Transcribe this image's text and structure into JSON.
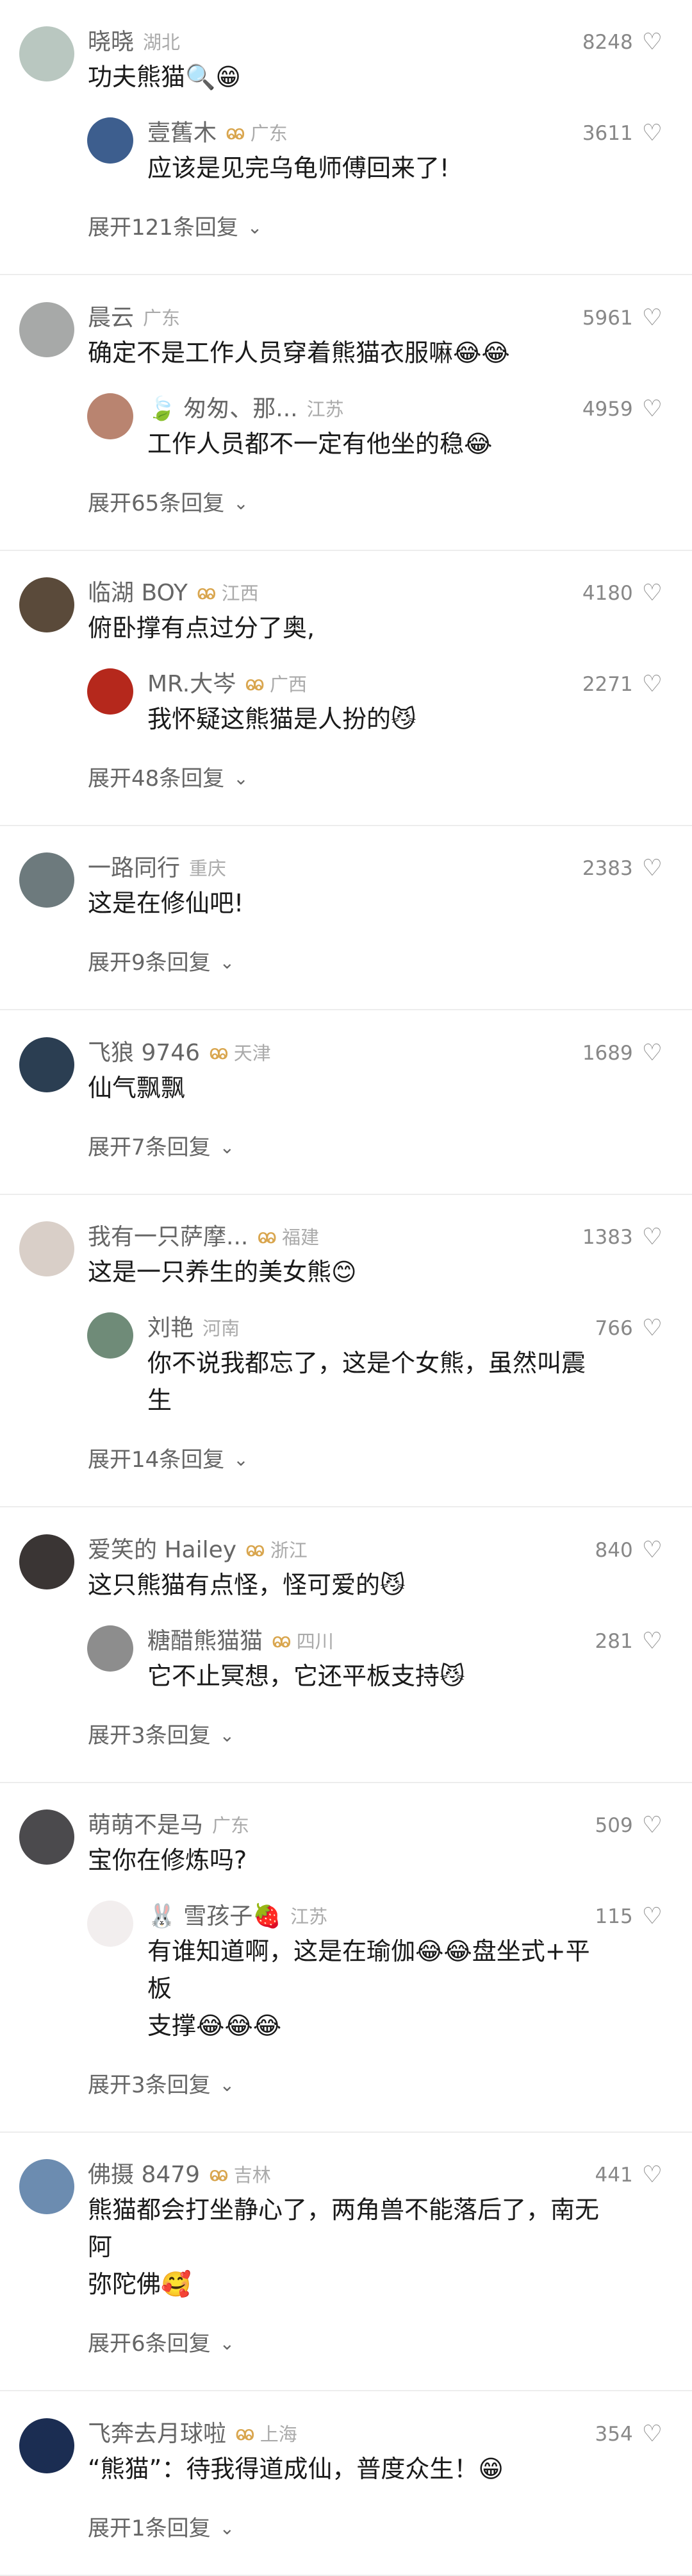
{
  "comments": [
    {
      "avatar_color": "#b9c7c0",
      "name": "晓晓",
      "fan": false,
      "location": "湖北",
      "likes": "8248",
      "text": "功夫熊猫🔍😁",
      "reply": {
        "avatar_color": "#3d5e8e",
        "name": "壹舊木",
        "fan": true,
        "location": "广东",
        "likes": "3611",
        "text": "应该是见完乌龟师傅回来了!"
      },
      "expand": "展开121条回复"
    },
    {
      "avatar_color": "#a7a9a8",
      "name": "晨云",
      "fan": false,
      "location": "广东",
      "likes": "5961",
      "text": "确定不是工作人员穿着熊猫衣服嘛😂😂",
      "reply": {
        "avatar_color": "#b98470",
        "name": "🍃 匆匆、那...",
        "fan": false,
        "location": "江苏",
        "likes": "4959",
        "text": "工作人员都不一定有他坐的稳😂"
      },
      "expand": "展开65条回复"
    },
    {
      "avatar_color": "#5a4a3a",
      "name": "临湖 BOY",
      "fan": true,
      "location": "江西",
      "likes": "4180",
      "text": "俯卧撑有点过分了奥,",
      "reply": {
        "avatar_color": "#b5281c",
        "name": "MR.大岑",
        "fan": true,
        "location": "广西",
        "likes": "2271",
        "text": "我怀疑这熊猫是人扮的😼"
      },
      "expand": "展开48条回复"
    },
    {
      "avatar_color": "#6d7a7d",
      "name": "一路同行",
      "fan": false,
      "location": "重庆",
      "likes": "2383",
      "text": "这是在修仙吧!",
      "reply": null,
      "expand": "展开9条回复"
    },
    {
      "avatar_color": "#2b3e52",
      "name": "飞狼 9746",
      "fan": true,
      "location": "天津",
      "likes": "1689",
      "text": "仙气飘飘",
      "reply": null,
      "expand": "展开7条回复"
    },
    {
      "avatar_color": "#d9cfc8",
      "name": "我有一只萨摩...",
      "fan": true,
      "location": "福建",
      "likes": "1383",
      "text": "这是一只养生的美女熊😊",
      "reply": {
        "avatar_color": "#6f8b78",
        "name": "刘艳",
        "fan": false,
        "location": "河南",
        "likes": "766",
        "text": "你不说我都忘了，这是个女熊，虽然叫震生"
      },
      "expand": "展开14条回复"
    },
    {
      "avatar_color": "#3a3534",
      "name": "爱笑的 Hailey",
      "fan": true,
      "location": "浙江",
      "likes": "840",
      "text": "这只熊猫有点怪，怪可爱的😼",
      "reply": {
        "avatar_color": "#8d8d8d",
        "name": "糖醋熊猫猫",
        "fan": true,
        "location": "四川",
        "likes": "281",
        "text": "它不止冥想，它还平板支持😼"
      },
      "expand": "展开3条回复"
    },
    {
      "avatar_color": "#4b4a4d",
      "name": "萌萌不是马",
      "fan": false,
      "location": "广东",
      "likes": "509",
      "text": "宝你在修炼吗?",
      "reply": {
        "avatar_color": "#f2eeee",
        "name": "🐰 雪孩子🍓",
        "fan": false,
        "location": "江苏",
        "likes": "115",
        "text": "有谁知道啊，这是在瑜伽😂😂盘坐式+平板\n支撑😂😂😂"
      },
      "expand": "展开3条回复"
    },
    {
      "avatar_color": "#6c8cb0",
      "name": "佛摄 8479",
      "fan": true,
      "location": "吉林",
      "likes": "441",
      "text": "熊猫都会打坐静心了，两角兽不能落后了，南无阿\n弥陀佛🥰",
      "reply": null,
      "expand": "展开6条回复"
    },
    {
      "avatar_color": "#1b2d52",
      "name": "飞奔去月球啦",
      "fan": true,
      "location": "上海",
      "likes": "354",
      "text": "“熊猫”：待我得道成仙，普度众生！😁",
      "reply": null,
      "expand": "展开1条回复"
    }
  ],
  "icons": {
    "fan": "fan-badge-icon",
    "heart": "heart-icon",
    "chevron": "chevron-down-icon"
  }
}
